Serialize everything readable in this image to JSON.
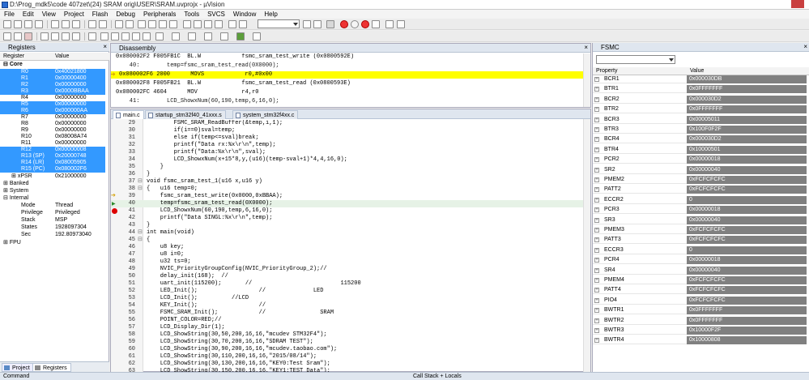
{
  "window": {
    "title": "D:\\Prog_mdk5\\code 407zet\\(24)  SRAM orig\\USER\\SRAM.uvprojx - µVision"
  },
  "menu": [
    "File",
    "Edit",
    "View",
    "Project",
    "Flash",
    "Debug",
    "Peripherals",
    "Tools",
    "SVCS",
    "Window",
    "Help"
  ],
  "registers": {
    "title": "Registers",
    "col_register": "Register",
    "col_value": "Value",
    "core_label": "Core",
    "core": [
      {
        "name": "R0",
        "value": "0x40021800",
        "sel": true
      },
      {
        "name": "R1",
        "value": "0x00000400",
        "sel": true
      },
      {
        "name": "R2",
        "value": "0x00000000",
        "sel": true
      },
      {
        "name": "R3",
        "value": "0x0000BBAA",
        "sel": true
      },
      {
        "name": "R4",
        "value": "0x00000000",
        "sel": false
      },
      {
        "name": "R5",
        "value": "0x00000000",
        "sel": true
      },
      {
        "name": "R6",
        "value": "0x000000AA",
        "sel": true
      },
      {
        "name": "R7",
        "value": "0x00000000",
        "sel": false
      },
      {
        "name": "R8",
        "value": "0x00000000",
        "sel": false
      },
      {
        "name": "R9",
        "value": "0x00000000",
        "sel": false
      },
      {
        "name": "R10",
        "value": "0x08008A74",
        "sel": false
      },
      {
        "name": "R11",
        "value": "0x00000000",
        "sel": false
      },
      {
        "name": "R12",
        "value": "0x00000008",
        "sel": true
      },
      {
        "name": "R13 (SP)",
        "value": "0x20000748",
        "sel": true
      },
      {
        "name": "R14 (LR)",
        "value": "0x08005905",
        "sel": true
      },
      {
        "name": "R15 (PC)",
        "value": "0x080002F6",
        "sel": true
      }
    ],
    "xpsr": {
      "name": "xPSR",
      "value": "0x21000000"
    },
    "banked": "Banked",
    "system": "System",
    "internal": "Internal",
    "internal_items": [
      {
        "name": "Mode",
        "value": "Thread"
      },
      {
        "name": "Privilege",
        "value": "Privileged"
      },
      {
        "name": "Stack",
        "value": "MSP"
      },
      {
        "name": "States",
        "value": "1928097304"
      },
      {
        "name": "Sec",
        "value": "192.80973040"
      }
    ],
    "fpu": "FPU",
    "tab_project": "Project",
    "tab_registers": "Registers"
  },
  "disassembly": {
    "title": "Disassembly",
    "lines": [
      {
        "text": "0x080002F2 F005FB1C  BL.W            fsmc_sram_test_write (0x0800592E)",
        "hl": false,
        "cls": "asm"
      },
      {
        "text": "    40:        temp=fsmc_sram_test_read(0X0000);",
        "hl": false,
        "cls": "src"
      },
      {
        "text": "0x080002F6 2000      MOVS            r0,#0x00",
        "hl": true,
        "cls": "asm"
      },
      {
        "text": "0x080002F8 F005FB21  BL.W            fsmc_sram_test_read (0x0800593E)",
        "hl": false,
        "cls": "asm"
      },
      {
        "text": "0x080002FC 4604      MOV             r4,r0",
        "hl": false,
        "cls": "asm"
      },
      {
        "text": "    41:        LCD_ShowxNum(60,190,temp,6,16,0);",
        "hl": false,
        "cls": "src"
      }
    ]
  },
  "editor": {
    "tabs": [
      {
        "label": "main.c",
        "active": true
      },
      {
        "label": "startup_stm32f40_41xxx.s",
        "active": false
      },
      {
        "label": "system_stm32f4xx.c",
        "active": false
      }
    ],
    "lines": [
      {
        "n": "29",
        "t": "        FSMC_SRAM_ReadBuffer(&temp,i,1);"
      },
      {
        "n": "30",
        "t": "        if(i==0)sval=temp;"
      },
      {
        "n": "31",
        "t": "        else if(temp<=sval)break;"
      },
      {
        "n": "32",
        "t": "        printf(\"Data rx:%x\\r\\n\",temp);"
      },
      {
        "n": "33",
        "t": "        printf(\"Data:%x\\r\\n\",sval);"
      },
      {
        "n": "34",
        "t": "        LCD_ShowxNum(x+15*8,y,(u16)(temp-sval+1)*4,4,16,0);"
      },
      {
        "n": "35",
        "t": "    }"
      },
      {
        "n": "36",
        "t": "}"
      },
      {
        "n": "37",
        "t": "void fsmc_sram_test_1(u16 x,u16 y)"
      },
      {
        "n": "38",
        "t": "{   u16 temp=0;"
      },
      {
        "n": "39",
        "t": "    fsmc_sram_test_write(0x0000,0xBBAA);"
      },
      {
        "n": "40",
        "t": "    temp=fsmc_sram_test_read(0X0000);"
      },
      {
        "n": "41",
        "t": "    LCD_ShowxNum(60,190,temp,6,16,0);"
      },
      {
        "n": "42",
        "t": "    printf(\"Data SINGL:%x\\r\\n\",temp);"
      },
      {
        "n": "43",
        "t": "}"
      },
      {
        "n": "44",
        "t": "int main(void)"
      },
      {
        "n": "45",
        "t": "{"
      },
      {
        "n": "46",
        "t": "    u8 key;"
      },
      {
        "n": "47",
        "t": "    u8 i=0;"
      },
      {
        "n": "48",
        "t": "    u32 ts=0;"
      },
      {
        "n": "49",
        "t": "    NVIC_PriorityGroupConfig(NVIC_PriorityGroup_2);//"
      },
      {
        "n": "50",
        "t": "    delay_init(168);  //"
      },
      {
        "n": "51",
        "t": "    uart_init(115200);       //                          115200"
      },
      {
        "n": "52",
        "t": "    LED_Init();                  //              LED"
      },
      {
        "n": "53",
        "t": "    LCD_Init();          //LCD"
      },
      {
        "n": "54",
        "t": "    KEY_Init();                  //"
      },
      {
        "n": "55",
        "t": "    FSMC_SRAM_Init();            //                SRAM"
      },
      {
        "n": "56",
        "t": "    POINT_COLOR=RED;//"
      },
      {
        "n": "57",
        "t": "    LCD_Display_Dir(1);"
      },
      {
        "n": "58",
        "t": "    LCD_ShowString(30,50,200,16,16,\"mcudev STM32F4\");"
      },
      {
        "n": "59",
        "t": "    LCD_ShowString(30,70,200,16,16,\"SDRAM TEST\");"
      },
      {
        "n": "60",
        "t": "    LCD_ShowString(30,90,200,16,16,\"mcudev.taobao.com\");"
      },
      {
        "n": "61",
        "t": "    LCD_ShowString(30,110,200,16,16,\"2015/08/14\");"
      },
      {
        "n": "62",
        "t": "    LCD_ShowString(30,130,200,16,16,\"KEY0:Test Sram\");"
      },
      {
        "n": "63",
        "t": "    LCD_ShowString(30,150,200,16,16,\"KEY1:TEST Data\");"
      }
    ]
  },
  "fsmc": {
    "title": "FSMC",
    "col_property": "Property",
    "col_value": "Value",
    "props": [
      {
        "name": "BCR1",
        "value": "0x000030DB"
      },
      {
        "name": "BTR1",
        "value": "0x0FFFFFFF"
      },
      {
        "name": "BCR2",
        "value": "0x000030D2"
      },
      {
        "name": "BTR2",
        "value": "0x0FFFFFFF"
      },
      {
        "name": "BCR3",
        "value": "0x00005011"
      },
      {
        "name": "BTR3",
        "value": "0x100F0F2F"
      },
      {
        "name": "BCR4",
        "value": "0x000030D2"
      },
      {
        "name": "BTR4",
        "value": "0x10000501"
      },
      {
        "name": "PCR2",
        "value": "0x00000018"
      },
      {
        "name": "SR2",
        "value": "0x00000040"
      },
      {
        "name": "PMEM2",
        "value": "0xFCFCFCFC"
      },
      {
        "name": "PATT2",
        "value": "0xFCFCFCFC"
      },
      {
        "name": "ECCR2",
        "value": "0"
      },
      {
        "name": "PCR3",
        "value": "0x00000018"
      },
      {
        "name": "SR3",
        "value": "0x00000040"
      },
      {
        "name": "PMEM3",
        "value": "0xFCFCFCFC"
      },
      {
        "name": "PATT3",
        "value": "0xFCFCFCFC"
      },
      {
        "name": "ECCR3",
        "value": "0"
      },
      {
        "name": "PCR4",
        "value": "0x00000018"
      },
      {
        "name": "SR4",
        "value": "0x00000040"
      },
      {
        "name": "PMEM4",
        "value": "0xFCFCFCFC"
      },
      {
        "name": "PATT4",
        "value": "0xFCFCFCFC"
      },
      {
        "name": "PIO4",
        "value": "0xFCFCFCFC"
      },
      {
        "name": "BWTR1",
        "value": "0x0FFFFFFF"
      },
      {
        "name": "BWTR2",
        "value": "0x0FFFFFFF"
      },
      {
        "name": "BWTR3",
        "value": "0x10000F2F"
      },
      {
        "name": "BWTR4",
        "value": "0x10000808"
      }
    ]
  },
  "bottom": {
    "command": "Command",
    "callstack": "Call Stack + Locals"
  },
  "colors": {
    "selection": "#3399ff",
    "current_line": "#ffff00",
    "fsmc_value_bg": "#808080",
    "comment": "#008000"
  }
}
